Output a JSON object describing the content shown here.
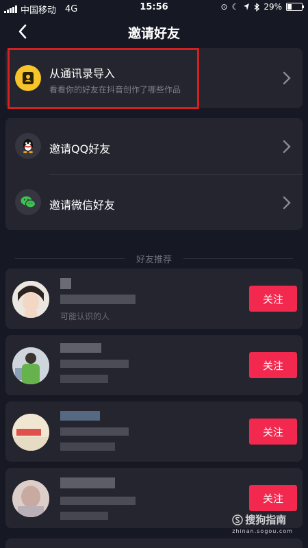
{
  "status_bar": {
    "carrier": "中国移动",
    "network": "4G",
    "time": "15:56",
    "battery": "29%",
    "battery_level": 0.29
  },
  "nav": {
    "title": "邀请好友"
  },
  "contacts": {
    "label": "从通讯录导入",
    "sub": "看看你的好友在抖音创作了哪些作品"
  },
  "invite_qq": {
    "label": "邀请QQ好友"
  },
  "invite_wechat": {
    "label": "邀请微信好友"
  },
  "section": {
    "title": "好友推荐"
  },
  "friends": [
    {
      "hint": "可能认识的人",
      "button": "关注"
    },
    {
      "button": "关注"
    },
    {
      "button": "关注"
    },
    {
      "button": "关注"
    }
  ],
  "watermark": {
    "brand": "搜狗指南",
    "domain": "zhinan.sogou.com"
  }
}
